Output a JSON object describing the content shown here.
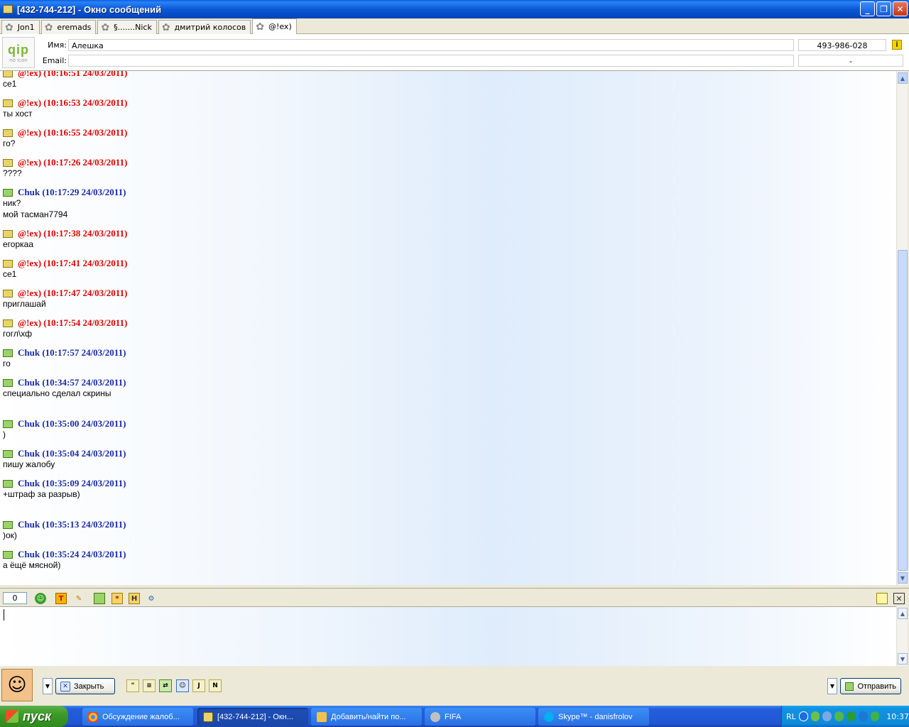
{
  "window": {
    "title": "[432-744-212] - Окно сообщений",
    "minimize": "_",
    "restore": "❐",
    "close": "✕"
  },
  "tabs": [
    {
      "label": "Jon1",
      "active": false
    },
    {
      "label": "eremads",
      "active": false
    },
    {
      "label": "§.......Nick",
      "active": false
    },
    {
      "label": "дмитрий колосов",
      "active": false
    },
    {
      "label": "@!ex)",
      "active": true
    }
  ],
  "contact": {
    "avatar_logo": "qip",
    "avatar_caption": "no icon",
    "name_label": "Имя:",
    "name_value": "Алешка",
    "email_label": "Email:",
    "email_value": "",
    "uin": "493-986-028",
    "uin2": "-"
  },
  "messages": [
    {
      "sender": "@!ex)",
      "time": "(10:16:51 24/03/2011)",
      "type": "lex",
      "text": "се1"
    },
    {
      "sender": "@!ex)",
      "time": "(10:16:53 24/03/2011)",
      "type": "lex",
      "text": "ты хост"
    },
    {
      "sender": "@!ex)",
      "time": "(10:16:55 24/03/2011)",
      "type": "lex",
      "text": "го?"
    },
    {
      "sender": "@!ex)",
      "time": "(10:17:26 24/03/2011)",
      "type": "lex",
      "text": "????"
    },
    {
      "sender": "Chuk",
      "time": "(10:17:29 24/03/2011)",
      "type": "chuk",
      "text": "ник?\nмой тасман7794"
    },
    {
      "sender": "@!ex)",
      "time": "(10:17:38 24/03/2011)",
      "type": "lex",
      "text": "егоркаа"
    },
    {
      "sender": "@!ex)",
      "time": "(10:17:41 24/03/2011)",
      "type": "lex",
      "text": "се1"
    },
    {
      "sender": "@!ex)",
      "time": "(10:17:47 24/03/2011)",
      "type": "lex",
      "text": "приглашай"
    },
    {
      "sender": "@!ex)",
      "time": "(10:17:54 24/03/2011)",
      "type": "lex",
      "text": "гогл\\хф"
    },
    {
      "sender": "Chuk",
      "time": "(10:17:57 24/03/2011)",
      "type": "chuk",
      "text": "го"
    },
    {
      "sender": "Chuk",
      "time": "(10:34:57 24/03/2011)",
      "type": "chuk",
      "text": "специально сделал скрины"
    },
    {
      "sender": "Chuk",
      "time": "(10:35:00 24/03/2011)",
      "type": "chuk",
      "text": ")"
    },
    {
      "sender": "Chuk",
      "time": "(10:35:04 24/03/2011)",
      "type": "chuk",
      "text": "пишу жалобу"
    },
    {
      "sender": "Chuk",
      "time": "(10:35:09 24/03/2011)",
      "type": "chuk",
      "text": "+штраф за разрыв)"
    },
    {
      "sender": "Chuk",
      "time": "(10:35:13 24/03/2011)",
      "type": "chuk",
      "text": ")ок)"
    },
    {
      "sender": "Chuk",
      "time": "(10:35:24 24/03/2011)",
      "type": "chuk",
      "text": "а ёщё мясной)"
    }
  ],
  "input": {
    "char_counter": "0",
    "value": ""
  },
  "buttons": {
    "close_label": "Закрыть",
    "send_label": "Отправить"
  },
  "taskbar": {
    "start_label": "пуск",
    "tasks": [
      {
        "label": "Обсуждение жалоб...",
        "active": false
      },
      {
        "label": "[432-744-212] - Окн...",
        "active": true
      },
      {
        "label": "Добавить/найти по...",
        "active": false
      },
      {
        "label": "FIFA",
        "active": false
      },
      {
        "label": "Skype™ - danisfrolov",
        "active": false
      }
    ],
    "language": "RL",
    "clock": "10:37"
  },
  "colors": {
    "lex_sender": "#e00000",
    "chuk_sender": "#1a2aa8",
    "titlebar": "#0a58d6"
  }
}
